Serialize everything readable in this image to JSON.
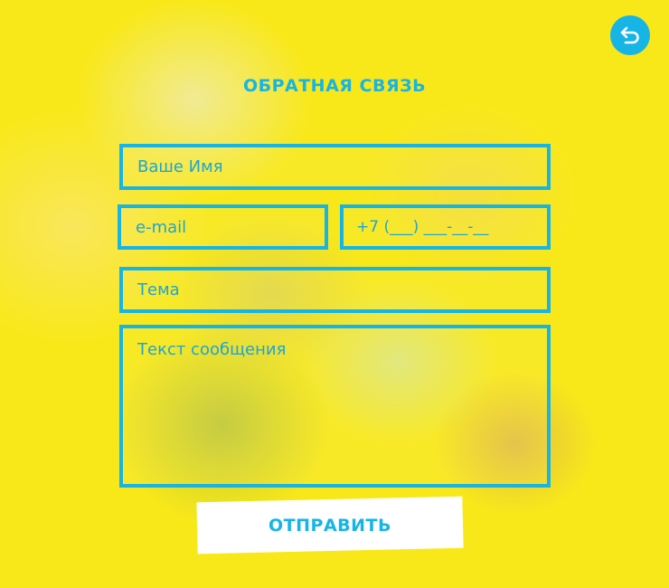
{
  "header": {
    "back_icon": "back-arrow-icon",
    "title": "ОБРАТНАЯ СВЯЗЬ"
  },
  "form": {
    "name_placeholder": "Ваше Имя",
    "email_placeholder": "e-mail",
    "phone_placeholder": "+7 (___) ___-__-__",
    "topic_placeholder": "Тема",
    "message_placeholder": "Текст сообщения",
    "submit_label": "ОТПРАВИТЬ"
  },
  "colors": {
    "accent": "#16b5e6",
    "background": "#f8e81a",
    "button_bg": "#ffffff"
  }
}
